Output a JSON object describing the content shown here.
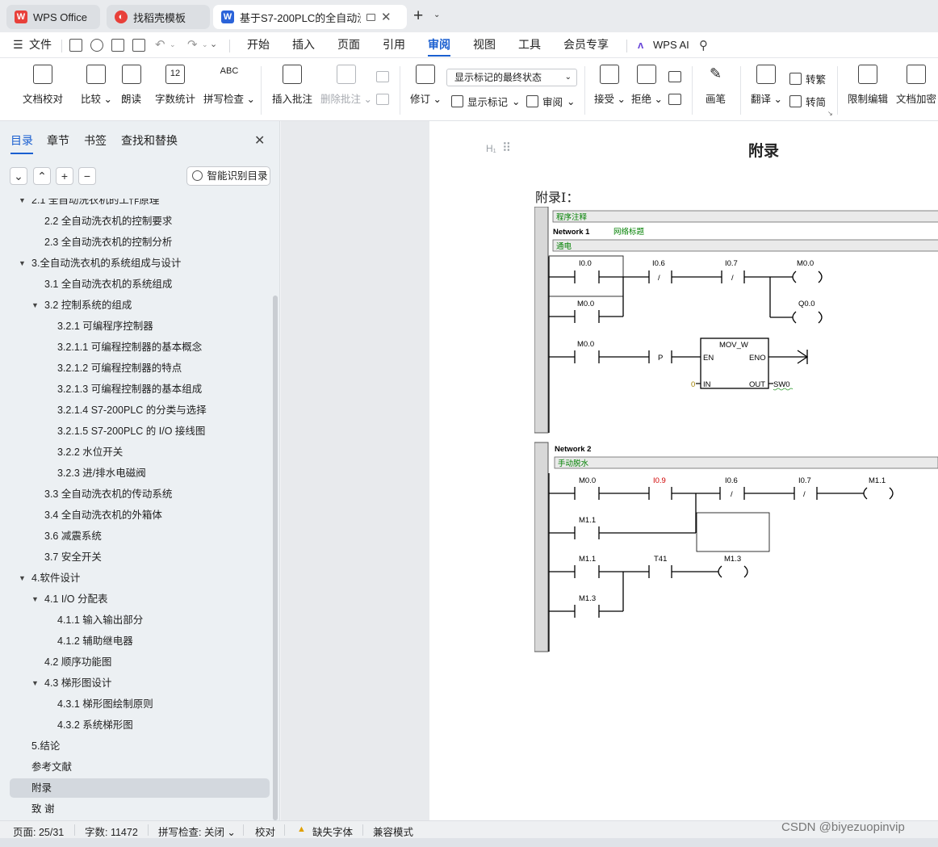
{
  "tabs": [
    {
      "label": "WPS Office"
    },
    {
      "label": "找稻壳模板"
    },
    {
      "label": "基于S7-200PLC的全自动洗衣"
    }
  ],
  "menu": {
    "file": "文件",
    "items": [
      "开始",
      "插入",
      "页面",
      "引用",
      "审阅",
      "视图",
      "工具",
      "会员专享"
    ],
    "active": "审阅",
    "wps_ai": "WPS AI"
  },
  "ribbon": {
    "doc_proof": "文档校对",
    "compare": "比较",
    "read_aloud": "朗读",
    "word_count": "字数统计",
    "spell_check": "拼写检查",
    "spell_icon_text": "ABC",
    "insert_comment": "插入批注",
    "delete_comment": "删除批注",
    "revise": "修订",
    "markup_select": "显示标记的最终状态",
    "show_markup": "显示标记",
    "review": "审阅",
    "accept": "接受",
    "reject": "拒绝",
    "pen": "画笔",
    "translate": "翻译",
    "to_traditional": "转繁",
    "to_simplified": "转简",
    "restrict_edit": "限制编辑",
    "doc_encrypt": "文档加密",
    "word_count_icon": "12"
  },
  "sidebar": {
    "tabs": [
      "目录",
      "章节",
      "书签",
      "查找和替换"
    ],
    "smart_toc": "智能识别目录",
    "toc": [
      {
        "label": "2.1 全自动洗衣机的工作原理",
        "level": 1,
        "arrow": "▼"
      },
      {
        "label": "2.2  全自动洗衣机的控制要求",
        "level": 2
      },
      {
        "label": "2.3 全自动洗衣机的控制分析",
        "level": 2
      },
      {
        "label": "3.全自动洗衣机的系统组成与设计",
        "level": 1,
        "arrow": "▼"
      },
      {
        "label": "3.1  全自动洗衣机的系统组成",
        "level": 2
      },
      {
        "label": "3.2 控制系统的组成",
        "level": 2,
        "arrow": "▼"
      },
      {
        "label": "3.2.1 可编程序控制器",
        "level": 3
      },
      {
        "label": "3.2.1.1 可编程控制器的基本概念",
        "level": 3
      },
      {
        "label": "3.2.1.2 可编程控制器的特点",
        "level": 3
      },
      {
        "label": "3.2.1.3 可编程控制器的基本组成",
        "level": 3
      },
      {
        "label": "3.2.1.4 S7-200PLC 的分类与选择",
        "level": 3
      },
      {
        "label": "3.2.1.5 S7-200PLC 的 I/O 接线图",
        "level": 3
      },
      {
        "label": "3.2.2 水位开关",
        "level": 3
      },
      {
        "label": "3.2.3  进/排水电磁阀",
        "level": 3
      },
      {
        "label": "3.3 全自动洗衣机的传动系统",
        "level": 2
      },
      {
        "label": "3.4 全自动洗衣机的外箱体",
        "level": 2
      },
      {
        "label": "3.6 减震系统",
        "level": 2
      },
      {
        "label": "3.7 安全开关",
        "level": 2
      },
      {
        "label": "4.软件设计",
        "level": 1,
        "arrow": "▼"
      },
      {
        "label": "4.1 I/O 分配表",
        "level": 2,
        "arrow": "▼"
      },
      {
        "label": "4.1.1 输入输出部分",
        "level": 3
      },
      {
        "label": "4.1.2 辅助继电器",
        "level": 3
      },
      {
        "label": "4.2 顺序功能图",
        "level": 2
      },
      {
        "label": "4.3 梯形图设计",
        "level": 2,
        "arrow": "▼"
      },
      {
        "label": "4.3.1  梯形图绘制原则",
        "level": 3
      },
      {
        "label": "4.3.2 系统梯形图",
        "level": 3
      },
      {
        "label": "5.结论",
        "level": 1
      },
      {
        "label": "参考文献",
        "level": 1
      },
      {
        "label": "附录",
        "level": 1,
        "selected": true
      },
      {
        "label": "致  谢",
        "level": 1
      }
    ]
  },
  "document": {
    "heading_marker": "H₁",
    "heading": "附录",
    "appendix_label": "附录Ⅰ：",
    "program_comment": "程序注释",
    "network1": "Network 1",
    "network1_title": "网络标题",
    "network1_comment": "通电",
    "network2": "Network 2",
    "network2_comment": "手动脱水",
    "ladder": {
      "i00": "I0.0",
      "i06": "I0.6",
      "i07": "I0.7",
      "m00": "M0.0",
      "q00": "Q0.0",
      "m00b": "M0.0",
      "m00c": "M0.0",
      "p": "P",
      "mov": "MOV_W",
      "en": "EN",
      "eno": "ENO",
      "zero": "0",
      "in": "IN",
      "out": "OUT",
      "sw0": "SW0",
      "m00d": "M0.0",
      "i09": "I0.9",
      "i06b": "I0.6",
      "i07b": "I0.7",
      "m11": "M1.1",
      "m11b": "M1.1",
      "m11c": "M1.1",
      "t41": "T41",
      "m13": "M1.3",
      "m13b": "M1.3",
      "slash": "/"
    }
  },
  "status": {
    "page": "页面: 25/31",
    "words": "字数: 11472",
    "spell": "拼写检查: 关闭",
    "proof": "校对",
    "missing_font": "缺失字体",
    "compat": "兼容模式"
  },
  "watermark": "CSDN @biyezuopinvip",
  "colors": {
    "accent": "#1a5fd0",
    "wps_red": "#e8403a",
    "ladder_green": "#008000",
    "ladder_red": "#d00000"
  }
}
